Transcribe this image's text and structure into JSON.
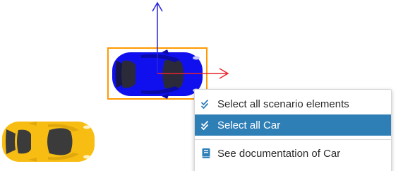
{
  "scene": {
    "selected_car": {
      "color": "#1010ee",
      "selection_box_color": "#ff9900",
      "axis_x_color": "#e8252b",
      "axis_y_color": "#2626d8"
    },
    "other_car": {
      "color": "#f8bd12"
    }
  },
  "context_menu": {
    "items": [
      {
        "label": "Select all scenario elements",
        "icon": "double-check-icon",
        "highlighted": false
      },
      {
        "label": "Select all Car",
        "icon": "double-check-icon",
        "highlighted": true
      },
      {
        "label": "See documentation of Car",
        "icon": "book-icon",
        "highlighted": false
      }
    ],
    "highlight_color": "#2f7fb7",
    "icon_color": "#2f7fb7"
  }
}
